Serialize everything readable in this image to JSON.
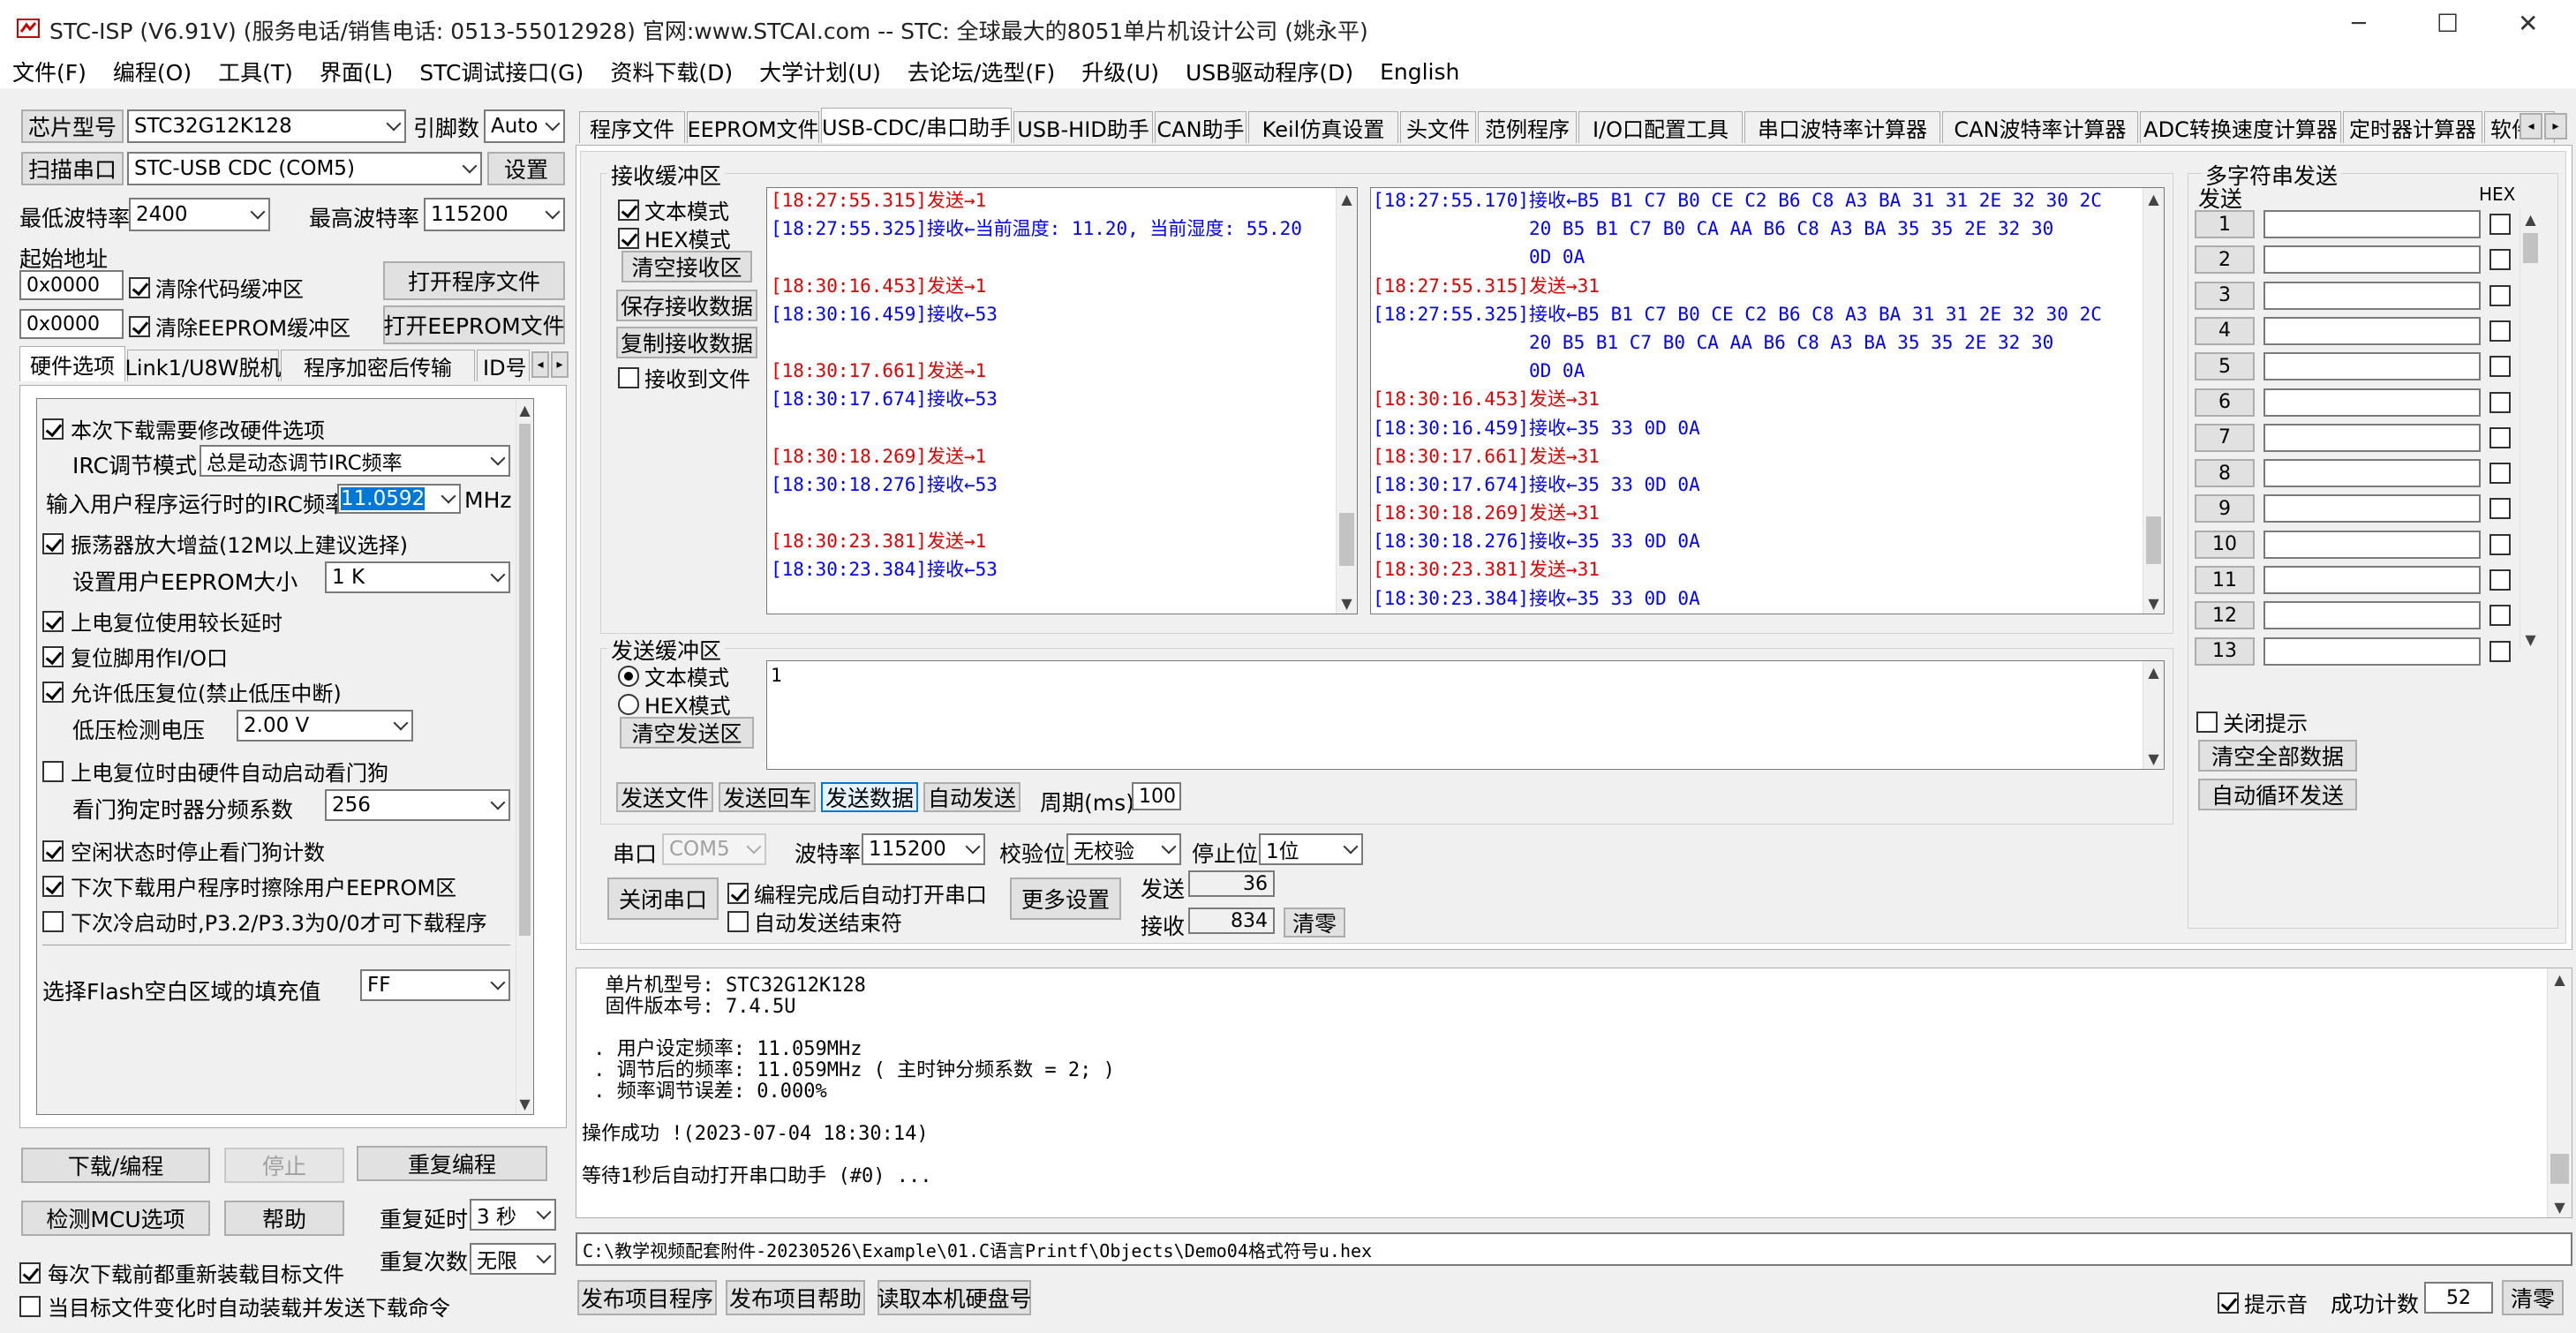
{
  "window": {
    "title": "STC-ISP (V6.91V) (服务电话/销售电话: 0513-55012928) 官网:www.STCAI.com  -- STC: 全球最大的8051单片机设计公司 (姚永平)",
    "minimize": "─",
    "maximize": "☐",
    "close": "✕"
  },
  "menu": [
    "文件(F)",
    "编程(O)",
    "工具(T)",
    "界面(L)",
    "STC调试接口(G)",
    "资料下载(D)",
    "大学计划(U)",
    "去论坛/选型(F)",
    "升级(U)",
    "USB驱动程序(D)",
    "English"
  ],
  "left": {
    "chip_btn": "芯片型号",
    "chip_value": "STC32G12K128",
    "pins_label": "引脚数",
    "pins_value": "Auto",
    "scan_btn": "扫描串口",
    "port_value": "STC-USB CDC (COM5)",
    "settings_btn": "设置",
    "min_baud_label": "最低波特率",
    "min_baud": "2400",
    "max_baud_label": "最高波特率",
    "max_baud": "115200",
    "start_addr_label": "起始地址",
    "addr1": "0x0000",
    "addr2": "0x0000",
    "clear_code": "清除代码缓冲区",
    "clear_eeprom": "清除EEPROM缓冲区",
    "open_prog_btn": "打开程序文件",
    "open_eeprom_btn": "打开EEPROM文件",
    "tabs": [
      "硬件选项",
      "Link1/U8W脱机",
      "程序加密后传输",
      "ID号"
    ],
    "opts": {
      "o1": "本次下载需要修改硬件选项",
      "irc_mode_label": "IRC调节模式",
      "irc_mode_value": "总是动态调节IRC频率",
      "irc_freq_label": "输入用户程序运行时的IRC频率",
      "irc_freq_value": "11.0592",
      "irc_unit": "MHz",
      "o2": "振荡器放大增益(12M以上建议选择)",
      "eeprom_size_label": "设置用户EEPROM大小",
      "eeprom_size_value": "1    K",
      "o3": "上电复位使用较长延时",
      "o4": "复位脚用作I/O口",
      "o5": "允许低压复位(禁止低压中断)",
      "lv_label": "低压检测电压",
      "lv_value": "2.00 V",
      "o6": "上电复位时由硬件自动启动看门狗",
      "wdt_label": "看门狗定时器分频系数",
      "wdt_value": "256",
      "o7": "空闲状态时停止看门狗计数",
      "o8": "下次下载用户程序时擦除用户EEPROM区",
      "o9": "下次冷启动时,P3.2/P3.3为0/0才可下载程序",
      "fill_label": "选择Flash空白区域的填充值",
      "fill_value": "FF"
    },
    "download_btn": "下载/编程",
    "stop_btn": "停止",
    "reprogram_btn": "重复编程",
    "detect_btn": "检测MCU选项",
    "help_btn": "帮助",
    "delay_label": "重复延时",
    "delay_value": "3 秒",
    "count_label": "重复次数",
    "count_value": "无限",
    "reload_each": "每次下载前都重新装载目标文件",
    "auto_send": "当目标文件变化时自动装载并发送下载命令"
  },
  "tabs": [
    "程序文件",
    "EEPROM文件",
    "USB-CDC/串口助手",
    "USB-HID助手",
    "CAN助手",
    "Keil仿真设置",
    "头文件",
    "范例程序",
    "I/O口配置工具",
    "串口波特率计算器",
    "CAN波特率计算器",
    "ADC转换速度计算器",
    "定时器计算器",
    "软件"
  ],
  "serial": {
    "recv_title": "接收缓冲区",
    "text_mode": "文本模式",
    "hex_mode": "HEX模式",
    "clear_recv": "清空接收区",
    "save_recv": "保存接收数据",
    "copy_recv": "复制接收数据",
    "recv_to_file": "接收到文件",
    "text_lines": [
      {
        "c": "red",
        "t": "[18:27:55.315]发送→1"
      },
      {
        "c": "blue",
        "t": "[18:27:55.325]接收←当前温度: 11.20, 当前湿度: 55.20"
      },
      {
        "c": "",
        "t": ""
      },
      {
        "c": "red",
        "t": "[18:30:16.453]发送→1"
      },
      {
        "c": "blue",
        "t": "[18:30:16.459]接收←53"
      },
      {
        "c": "",
        "t": ""
      },
      {
        "c": "red",
        "t": "[18:30:17.661]发送→1"
      },
      {
        "c": "blue",
        "t": "[18:30:17.674]接收←53"
      },
      {
        "c": "",
        "t": ""
      },
      {
        "c": "red",
        "t": "[18:30:18.269]发送→1"
      },
      {
        "c": "blue",
        "t": "[18:30:18.276]接收←53"
      },
      {
        "c": "",
        "t": ""
      },
      {
        "c": "red",
        "t": "[18:30:23.381]发送→1"
      },
      {
        "c": "blue",
        "t": "[18:30:23.384]接收←53"
      }
    ],
    "hex_lines": [
      {
        "c": "blue",
        "t": "[18:27:55.170]接收←B5 B1 C7 B0 CE C2 B6 C8 A3 BA 31 31 2E 32 30 2C"
      },
      {
        "c": "blue",
        "t": "              20 B5 B1 C7 B0 CA AA B6 C8 A3 BA 35 35 2E 32 30"
      },
      {
        "c": "blue",
        "t": "              0D 0A"
      },
      {
        "c": "red",
        "t": "[18:27:55.315]发送→31"
      },
      {
        "c": "blue",
        "t": "[18:27:55.325]接收←B5 B1 C7 B0 CE C2 B6 C8 A3 BA 31 31 2E 32 30 2C"
      },
      {
        "c": "blue",
        "t": "              20 B5 B1 C7 B0 CA AA B6 C8 A3 BA 35 35 2E 32 30"
      },
      {
        "c": "blue",
        "t": "              0D 0A"
      },
      {
        "c": "red",
        "t": "[18:30:16.453]发送→31"
      },
      {
        "c": "blue",
        "t": "[18:30:16.459]接收←35 33 0D 0A"
      },
      {
        "c": "red",
        "t": "[18:30:17.661]发送→31"
      },
      {
        "c": "blue",
        "t": "[18:30:17.674]接收←35 33 0D 0A"
      },
      {
        "c": "red",
        "t": "[18:30:18.269]发送→31"
      },
      {
        "c": "blue",
        "t": "[18:30:18.276]接收←35 33 0D 0A"
      },
      {
        "c": "red",
        "t": "[18:30:23.381]发送→31"
      },
      {
        "c": "blue",
        "t": "[18:30:23.384]接收←35 33 0D 0A"
      }
    ],
    "send_title": "发送缓冲区",
    "clear_send": "清空发送区",
    "send_text": "1",
    "send_file_btn": "发送文件",
    "send_echo_btn": "发送回车",
    "send_data_btn": "发送数据",
    "auto_send_btn": "自动发送",
    "period_label": "周期(ms)",
    "period_value": "100",
    "port_label": "串口",
    "port_value": "COM5",
    "baud_label": "波特率",
    "baud_value": "115200",
    "parity_label": "校验位",
    "parity_value": "无校验",
    "stop_label": "停止位",
    "stop_value": "1位",
    "close_port_btn": "关闭串口",
    "auto_open": "编程完成后自动打开串口",
    "auto_end": "自动发送结束符",
    "more_btn": "更多设置",
    "sent_label": "发送",
    "sent_value": "36",
    "recv_label": "接收",
    "recv_value": "834",
    "clear_btn": "清零"
  },
  "multi": {
    "title": "多字符串发送",
    "send_col": "发送",
    "hex_col": "HEX",
    "rows": [
      "1",
      "2",
      "3",
      "4",
      "5",
      "6",
      "7",
      "8",
      "9",
      "10",
      "11",
      "12",
      "13"
    ],
    "close_tip": "关闭提示",
    "clear_all": "清空全部数据",
    "auto_loop": "自动循环发送"
  },
  "log": {
    "lines": [
      "  单片机型号: STC32G12K128",
      "  固件版本号: 7.4.5U",
      "",
      " . 用户设定频率: 11.059MHz",
      " . 调节后的频率: 11.059MHz ( 主时钟分频系数 = 2; )",
      " . 频率调节误差: 0.000%",
      "",
      "操作成功 !(2023-07-04 18:30:14)",
      "",
      "等待1秒后自动打开串口助手 (#0) ..."
    ]
  },
  "path": "C:\\教学视频配套附件-20230526\\Example\\01.C语言Printf\\Objects\\Demo04格式符号u.hex",
  "bottom": {
    "publish_btn": "发布项目程序",
    "publish_help_btn": "发布项目帮助",
    "read_disk_btn": "读取本机硬盘号",
    "tip_sound": "提示音",
    "success_label": "成功计数",
    "success_value": "52",
    "clear_btn": "清零"
  }
}
